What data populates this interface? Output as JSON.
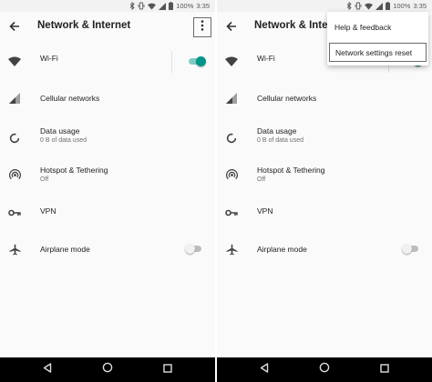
{
  "status_bar": {
    "battery_percent": "100%",
    "time": "3:35",
    "icons": [
      "bluetooth-icon",
      "vibrate-icon",
      "wifi-signal-icon",
      "cellular-signal-icon",
      "battery-icon"
    ]
  },
  "screens": [
    {
      "app_bar": {
        "title": "Network & Internet",
        "back_icon": "arrow-back-icon",
        "menu_icon": "more-vert-icon"
      },
      "settings": [
        {
          "title": "Wi-Fi",
          "subtitle": "",
          "icon": "wifi-icon",
          "switch": "on"
        },
        {
          "title": "Cellular networks",
          "subtitle": "",
          "icon": "cellular-icon"
        },
        {
          "title": "Data usage",
          "subtitle": "0 B of data used",
          "icon": "data-usage-icon"
        },
        {
          "title": "Hotspot & Tethering",
          "subtitle": "Off",
          "icon": "hotspot-icon"
        },
        {
          "title": "VPN",
          "subtitle": "",
          "icon": "vpn-key-icon"
        },
        {
          "title": "Airplane mode",
          "subtitle": "",
          "icon": "airplane-icon",
          "switch": "off"
        }
      ]
    },
    {
      "app_bar": {
        "title": "Network & Internet",
        "back_icon": "arrow-back-icon"
      },
      "settings": [
        {
          "title": "Wi-Fi",
          "subtitle": "",
          "icon": "wifi-icon",
          "switch": "on"
        },
        {
          "title": "Cellular networks",
          "subtitle": "",
          "icon": "cellular-icon"
        },
        {
          "title": "Data usage",
          "subtitle": "0 B of data used",
          "icon": "data-usage-icon"
        },
        {
          "title": "Hotspot & Tethering",
          "subtitle": "Off",
          "icon": "hotspot-icon"
        },
        {
          "title": "VPN",
          "subtitle": "",
          "icon": "vpn-key-icon"
        },
        {
          "title": "Airplane mode",
          "subtitle": "",
          "icon": "airplane-icon",
          "switch": "off"
        }
      ],
      "overflow_menu": {
        "items": [
          {
            "label": "Help & feedback"
          },
          {
            "label": "Network settings reset",
            "highlighted": true
          }
        ]
      }
    }
  ],
  "nav_bar": {
    "buttons": [
      "back-triangle-icon",
      "home-circle-icon",
      "recents-square-icon"
    ]
  },
  "colors": {
    "accent": "#009688",
    "accent_track": "#80cbc4",
    "background": "#fafafa",
    "status_bar": "#f2f2f2",
    "nav_bar": "#000000",
    "icon": "#424242",
    "secondary_text": "#6f6f6f",
    "switch_off_thumb": "#f1f1f1",
    "switch_off_track": "#bdbdbd"
  }
}
